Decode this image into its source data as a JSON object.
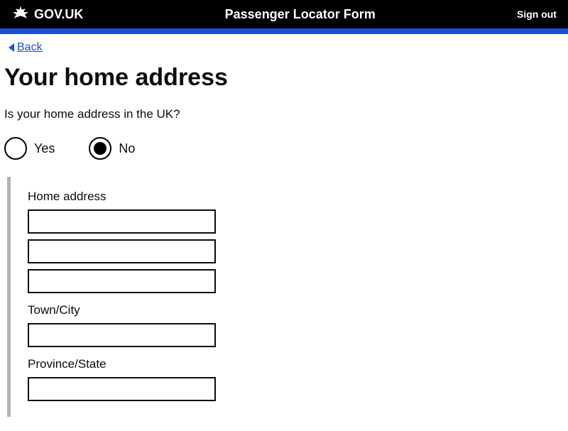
{
  "header": {
    "site": "GOV.UK",
    "service": "Passenger Locator Form",
    "signout": "Sign out"
  },
  "nav": {
    "back": "Back"
  },
  "page": {
    "title": "Your home address",
    "question": "Is your home address in the UK?"
  },
  "radio": {
    "yes_label": "Yes",
    "no_label": "No",
    "selected": "no"
  },
  "form": {
    "home_address_label": "Home address",
    "home_address_line1": "",
    "home_address_line2": "",
    "home_address_line3": "",
    "town_label": "Town/City",
    "town_value": "",
    "province_label": "Province/State",
    "province_value": ""
  }
}
